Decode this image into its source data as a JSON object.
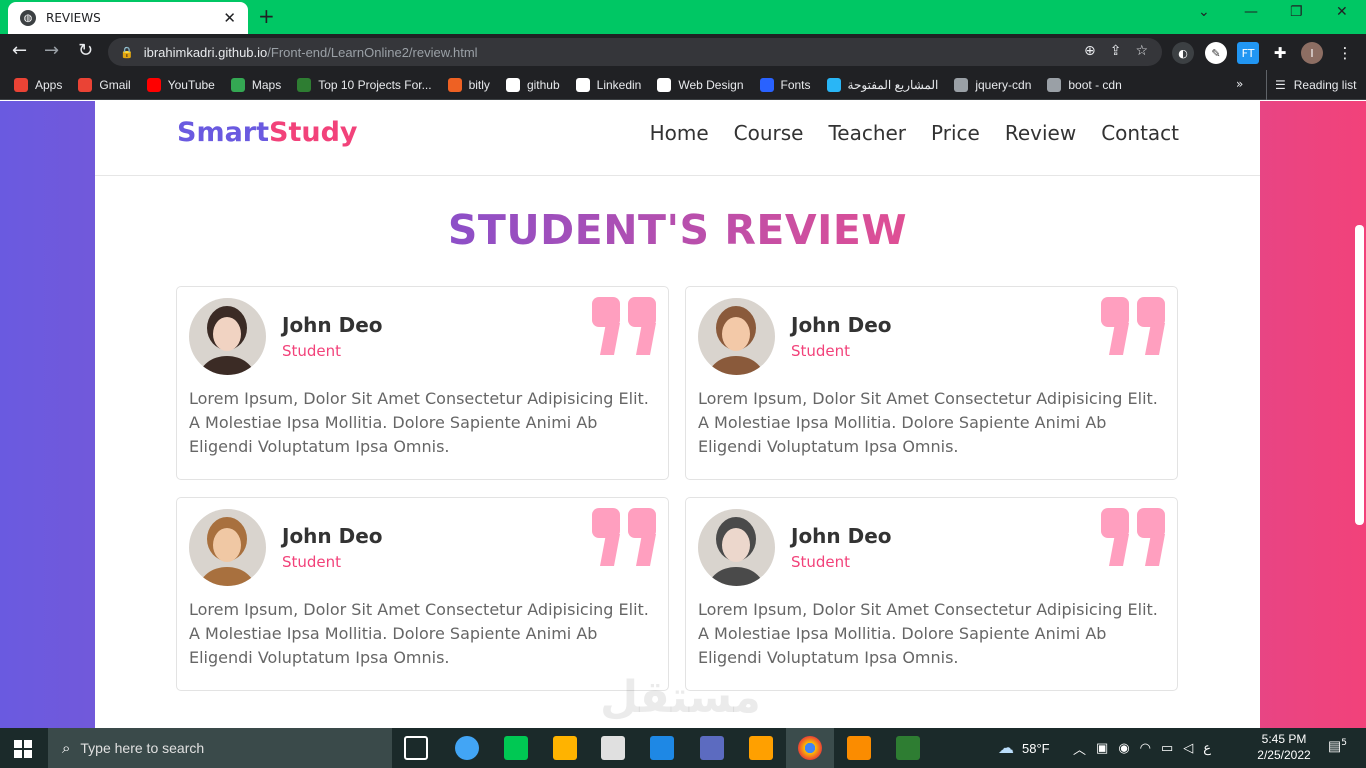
{
  "browser": {
    "tab_title": "REVIEWS",
    "url_host": "ibrahimkadri.github.io",
    "url_path": "/Front-end/LearnOnline2/review.html",
    "bookmarks": [
      {
        "label": "Apps",
        "color": "#ea4335"
      },
      {
        "label": "Gmail",
        "color": "#ea4335"
      },
      {
        "label": "YouTube",
        "color": "#ff0000"
      },
      {
        "label": "Maps",
        "color": "#34a853"
      },
      {
        "label": "Top 10 Projects For...",
        "color": "#2e7d32"
      },
      {
        "label": "bitly",
        "color": "#ee6123"
      },
      {
        "label": "github",
        "color": "#ffffff"
      },
      {
        "label": "Linkedin",
        "color": "#ffffff"
      },
      {
        "label": "Web Design",
        "color": "#ffffff"
      },
      {
        "label": "Fonts",
        "color": "#2962ff"
      },
      {
        "label": "المشاريع المفتوحة",
        "color": "#29b6f6"
      },
      {
        "label": "jquery-cdn",
        "color": "#9aa0a6"
      },
      {
        "label": "boot - cdn",
        "color": "#9aa0a6"
      }
    ],
    "more": "»",
    "reading_list": "Reading list",
    "profile_initial": "I",
    "ext_label": "FT"
  },
  "site": {
    "logo_part1": "Smart",
    "logo_part2": "Study",
    "nav": [
      "Home",
      "Course",
      "Teacher",
      "Price",
      "Review",
      "Contact"
    ],
    "section_title": "STUDENT'S REVIEW",
    "reviews": [
      {
        "name": "John Deo",
        "role": "Student",
        "text": "Lorem Ipsum, Dolor Sit Amet Consectetur Adipisicing Elit. A Molestiae Ipsa Mollitia. Dolore Sapiente Animi Ab Eligendi Voluptatum Ipsa Omnis."
      },
      {
        "name": "John Deo",
        "role": "Student",
        "text": "Lorem Ipsum, Dolor Sit Amet Consectetur Adipisicing Elit. A Molestiae Ipsa Mollitia. Dolore Sapiente Animi Ab Eligendi Voluptatum Ipsa Omnis."
      },
      {
        "name": "John Deo",
        "role": "Student",
        "text": "Lorem Ipsum, Dolor Sit Amet Consectetur Adipisicing Elit. A Molestiae Ipsa Mollitia. Dolore Sapiente Animi Ab Eligendi Voluptatum Ipsa Omnis."
      },
      {
        "name": "John Deo",
        "role": "Student",
        "text": "Lorem Ipsum, Dolor Sit Amet Consectetur Adipisicing Elit. A Molestiae Ipsa Mollitia. Dolore Sapiente Animi Ab Eligendi Voluptatum Ipsa Omnis."
      }
    ],
    "watermark": "مستقل"
  },
  "taskbar": {
    "search_placeholder": "Type here to search",
    "weather": "58°F",
    "lang": "ع",
    "time": "5:45 PM",
    "date": "2/25/2022",
    "notif_count": "5"
  },
  "colors": {
    "accent_purple": "#6a5ae0",
    "accent_pink": "#f2427a",
    "quote_pink": "#ff9fbf",
    "chrome_tab_green": "#00c764"
  }
}
